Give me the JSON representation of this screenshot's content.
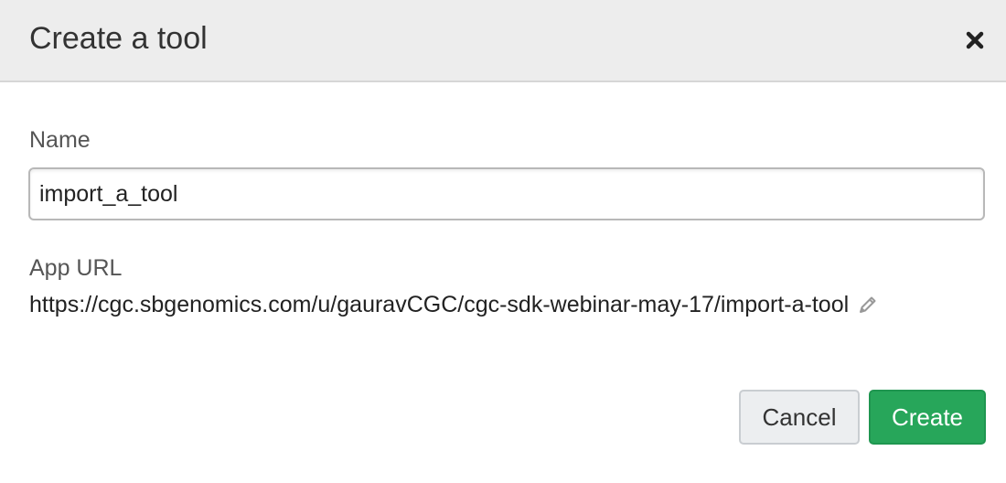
{
  "dialog": {
    "title": "Create a tool",
    "close_icon": "close-icon"
  },
  "form": {
    "name_label": "Name",
    "name_value": "import_a_tool",
    "url_label": "App URL",
    "url_value": "https://cgc.sbgenomics.com/u/gauravCGC/cgc-sdk-webinar-may-17/import-a-tool",
    "edit_icon": "pencil-icon"
  },
  "footer": {
    "cancel_label": "Cancel",
    "create_label": "Create"
  },
  "colors": {
    "header_bg": "#ededed",
    "primary_button": "#27a65a",
    "secondary_button": "#eceef0"
  }
}
